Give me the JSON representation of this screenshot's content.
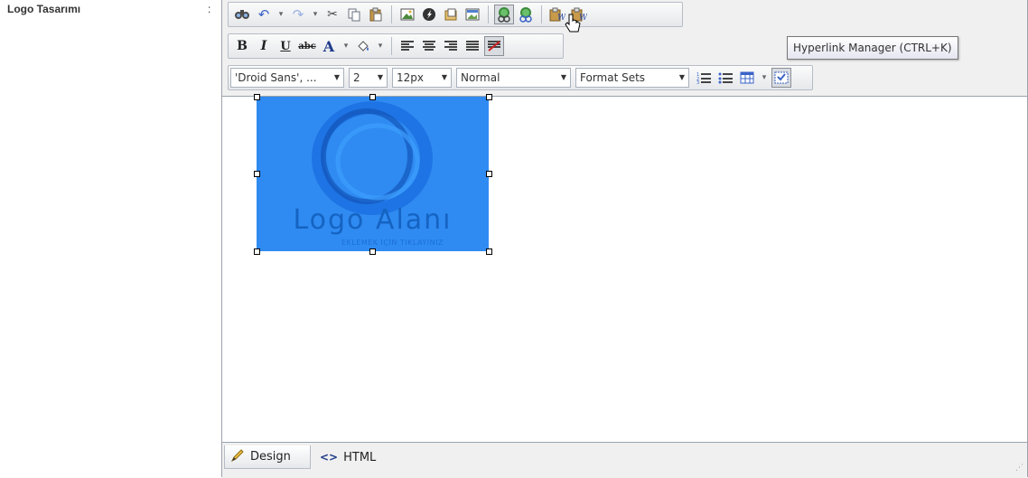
{
  "field": {
    "label": "Logo Tasarımı",
    "colon": ":"
  },
  "toolbar": {
    "fonts": {
      "family": "'Droid Sans', ...",
      "size": "2",
      "real_size": "12px",
      "paragraph": "Normal",
      "format_sets": "Format Sets"
    }
  },
  "tooltip": "Hyperlink Manager (CTRL+K)",
  "logo": {
    "title": "Logo Alanı",
    "subtitle": "EKLEMEK İÇİN TIKLAYINIZ"
  },
  "modes": {
    "design": "Design",
    "html": "HTML"
  },
  "colors": {
    "logo_bg": "#2f8bf2",
    "toolbar_bg": "#f0f0f0"
  }
}
